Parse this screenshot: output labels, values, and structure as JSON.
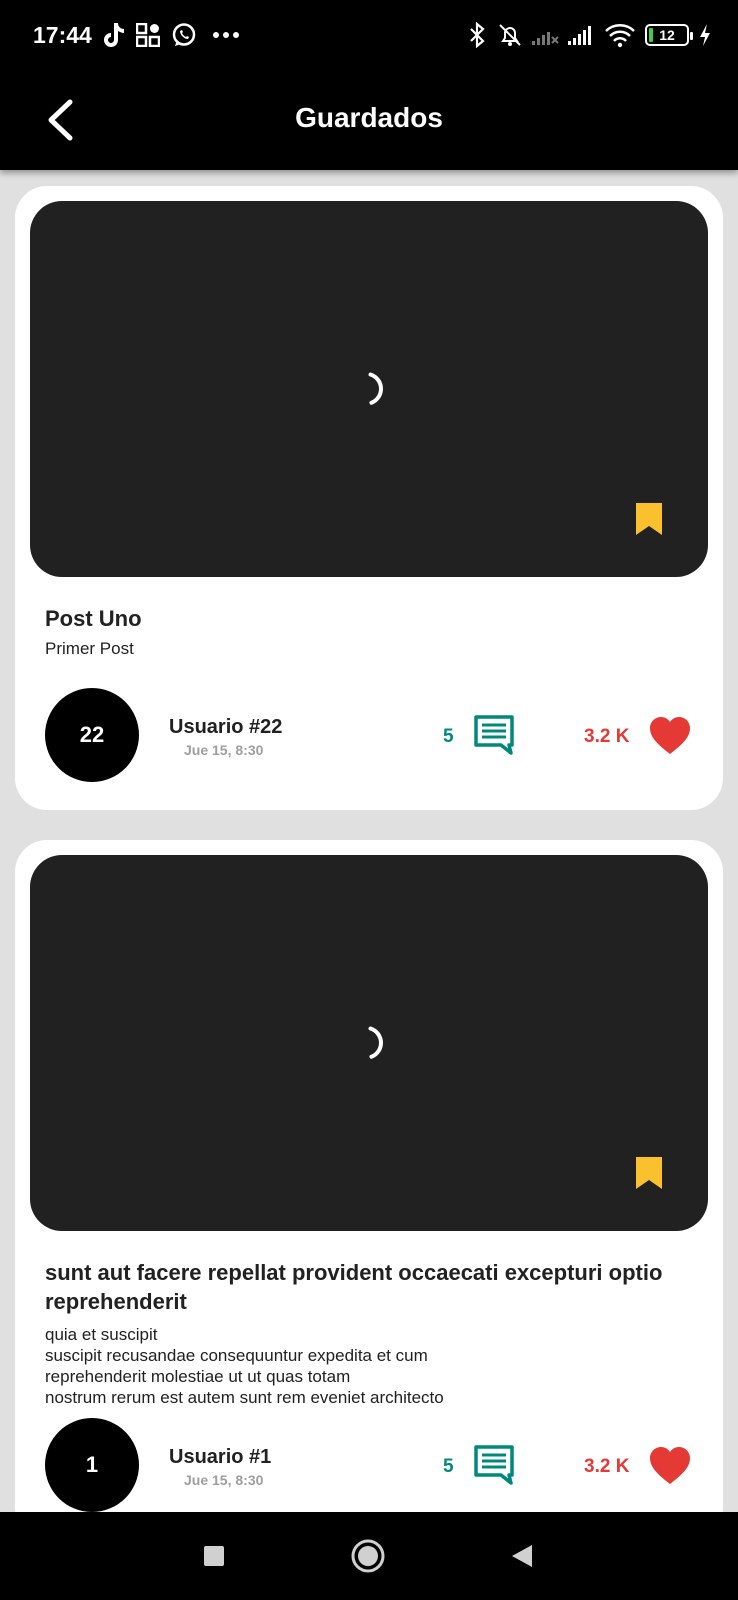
{
  "status_bar": {
    "time": "17:44",
    "battery_level": "12",
    "icons": [
      "tiktok-icon",
      "qr-grid-icon",
      "whatsapp-icon",
      "more-dots-icon",
      "bluetooth-icon",
      "alarm-off-icon",
      "signal-weak-icon",
      "signal-icon",
      "wifi-icon",
      "battery-icon",
      "charging-icon"
    ]
  },
  "app_bar": {
    "title": "Guardados",
    "back_icon": "back-arrow-icon"
  },
  "posts": [
    {
      "title": "Post Uno",
      "body": "Primer Post",
      "avatar_text": "22",
      "user": "Usuario #22",
      "date": "Jue 15, 8:30",
      "comments": "5",
      "likes": "3.2 K",
      "bookmarked": true
    },
    {
      "title": "sunt aut facere repellat provident occaecati excepturi optio reprehenderit",
      "body": "quia et suscipit\nsuscipit recusandae consequuntur expedita et cum\nreprehenderit molestiae ut ut quas totam\nnostrum rerum est autem sunt rem eveniet architecto",
      "avatar_text": "1",
      "user": "Usuario #1",
      "date": "Jue 15, 8:30",
      "comments": "5",
      "likes": "3.2 K",
      "bookmarked": true
    }
  ],
  "colors": {
    "app_bar": "#000000",
    "background": "#e0e0e0",
    "media_placeholder": "#212121",
    "bookmark": "#fbc02d",
    "comments": "#00897b",
    "likes": "#e53935",
    "date": "#9e9e9e"
  },
  "nav_bar": {
    "buttons": [
      "recents-square-icon",
      "home-circle-icon",
      "back-triangle-icon"
    ]
  }
}
